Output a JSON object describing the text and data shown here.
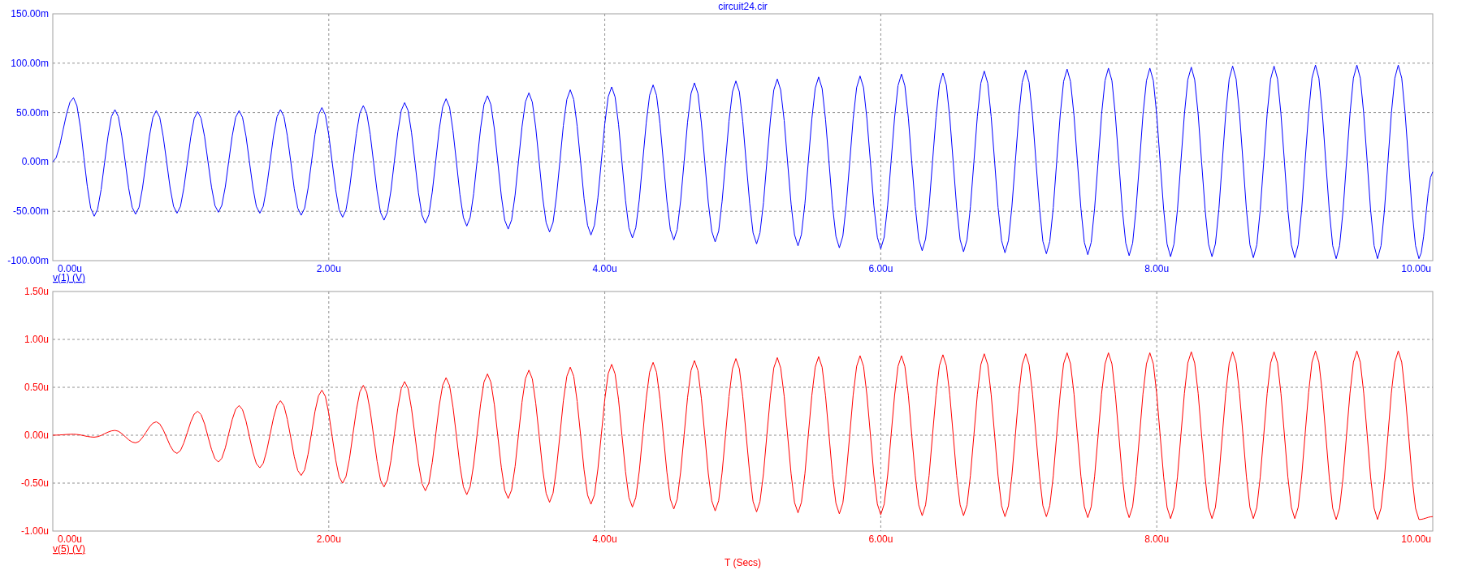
{
  "charts": [
    {
      "chart_data": {
        "type": "line",
        "title": "circuit24.cir",
        "grid": true,
        "xlim": [
          0,
          10
        ],
        "ylim": [
          -100,
          150
        ],
        "xticks": [
          {
            "value": 0,
            "label": "0.00u"
          },
          {
            "value": 2,
            "label": "2.00u"
          },
          {
            "value": 4,
            "label": "4.00u"
          },
          {
            "value": 6,
            "label": "6.00u"
          },
          {
            "value": 8,
            "label": "8.00u"
          },
          {
            "value": 10,
            "label": "10.00u"
          }
        ],
        "yticks": [
          {
            "value": 150,
            "label": "150.00m"
          },
          {
            "value": 100,
            "label": "100.00m"
          },
          {
            "value": 50,
            "label": "50.00m"
          },
          {
            "value": 0,
            "label": "0.00m"
          },
          {
            "value": -50,
            "label": "-50.00m"
          },
          {
            "value": -100,
            "label": "-100.00m"
          }
        ],
        "x": [
          0,
          0.15,
          0.3,
          0.45,
          0.6,
          0.75,
          0.9,
          1.05,
          1.2,
          1.35,
          1.5,
          1.65,
          1.8,
          1.95,
          2.1,
          2.25,
          2.4,
          2.55,
          2.7,
          2.85,
          3,
          3.15,
          3.3,
          3.45,
          3.6,
          3.75,
          3.9,
          4.05,
          4.2,
          4.35,
          4.5,
          4.65,
          4.8,
          4.95,
          5.1,
          5.25,
          5.4,
          5.55,
          5.7,
          5.85,
          6,
          6.15,
          6.3,
          6.45,
          6.6,
          6.75,
          6.9,
          7.05,
          7.2,
          7.35,
          7.5,
          7.65,
          7.8,
          7.95,
          8.1,
          8.25,
          8.4,
          8.55,
          8.7,
          8.85,
          9,
          9.15,
          9.3,
          9.45,
          9.6,
          9.75,
          9.9,
          10
        ],
        "series": [
          {
            "name": "v(1) (V)",
            "color": "#0000ff",
            "values": [
              0,
              65,
              -55,
              53,
              -53,
              52,
              -52,
              51,
              -51,
              52,
              -52,
              53,
              -54,
              55,
              -56,
              57,
              -59,
              60,
              -62,
              64,
              -65,
              67,
              -68,
              70,
              -71,
              73,
              -74,
              76,
              -77,
              78,
              -79,
              80,
              -81,
              82,
              -83,
              84,
              -85,
              86,
              -87,
              87,
              -88,
              89,
              -90,
              90,
              -91,
              92,
              -92,
              93,
              -93,
              94,
              -94,
              95,
              -95,
              95,
              -96,
              96,
              -96,
              97,
              -97,
              97,
              -97,
              98,
              -98,
              98,
              -98,
              98,
              -98,
              -10
            ]
          }
        ]
      }
    },
    {
      "chart_data": {
        "type": "line",
        "xlabel": "T (Secs)",
        "grid": true,
        "xlim": [
          0,
          10
        ],
        "ylim": [
          -1,
          1.5
        ],
        "xticks": [
          {
            "value": 0,
            "label": "0.00u"
          },
          {
            "value": 2,
            "label": "2.00u"
          },
          {
            "value": 4,
            "label": "4.00u"
          },
          {
            "value": 6,
            "label": "6.00u"
          },
          {
            "value": 8,
            "label": "8.00u"
          },
          {
            "value": 10,
            "label": "10.00u"
          }
        ],
        "yticks": [
          {
            "value": 1.5,
            "label": "1.50u"
          },
          {
            "value": 1,
            "label": "1.00u"
          },
          {
            "value": 0.5,
            "label": "0.50u"
          },
          {
            "value": 0,
            "label": "0.00u"
          },
          {
            "value": -0.5,
            "label": "-0.50u"
          },
          {
            "value": -1,
            "label": "-1.00u"
          }
        ],
        "x": [
          0,
          0.15,
          0.3,
          0.45,
          0.6,
          0.75,
          0.9,
          1.05,
          1.2,
          1.35,
          1.5,
          1.65,
          1.8,
          1.95,
          2.1,
          2.25,
          2.4,
          2.55,
          2.7,
          2.85,
          3,
          3.15,
          3.3,
          3.45,
          3.6,
          3.75,
          3.9,
          4.05,
          4.2,
          4.35,
          4.5,
          4.65,
          4.8,
          4.95,
          5.1,
          5.25,
          5.4,
          5.55,
          5.7,
          5.85,
          6,
          6.15,
          6.3,
          6.45,
          6.6,
          6.75,
          6.9,
          7.05,
          7.2,
          7.35,
          7.5,
          7.65,
          7.8,
          7.95,
          8.1,
          8.25,
          8.4,
          8.55,
          8.7,
          8.85,
          9,
          9.15,
          9.3,
          9.45,
          9.6,
          9.75,
          9.9,
          10
        ],
        "series": [
          {
            "name": "v(5) (V)",
            "color": "#ff0000",
            "values": [
              0,
              0.01,
              -0.02,
              0.05,
              -0.08,
              0.14,
              -0.19,
              0.25,
              -0.28,
              0.31,
              -0.34,
              0.36,
              -0.42,
              0.47,
              -0.5,
              0.52,
              -0.54,
              0.56,
              -0.58,
              0.6,
              -0.62,
              0.64,
              -0.66,
              0.68,
              -0.7,
              0.71,
              -0.72,
              0.74,
              -0.75,
              0.76,
              -0.77,
              0.78,
              -0.79,
              0.8,
              -0.8,
              0.81,
              -0.81,
              0.82,
              -0.82,
              0.83,
              -0.83,
              0.83,
              -0.84,
              0.84,
              -0.84,
              0.85,
              -0.85,
              0.85,
              -0.85,
              0.86,
              -0.86,
              0.86,
              -0.86,
              0.86,
              -0.87,
              0.87,
              -0.87,
              0.87,
              -0.87,
              0.87,
              -0.87,
              0.88,
              -0.88,
              0.88,
              -0.88,
              0.88,
              -0.88,
              -0.85
            ]
          }
        ]
      }
    }
  ]
}
